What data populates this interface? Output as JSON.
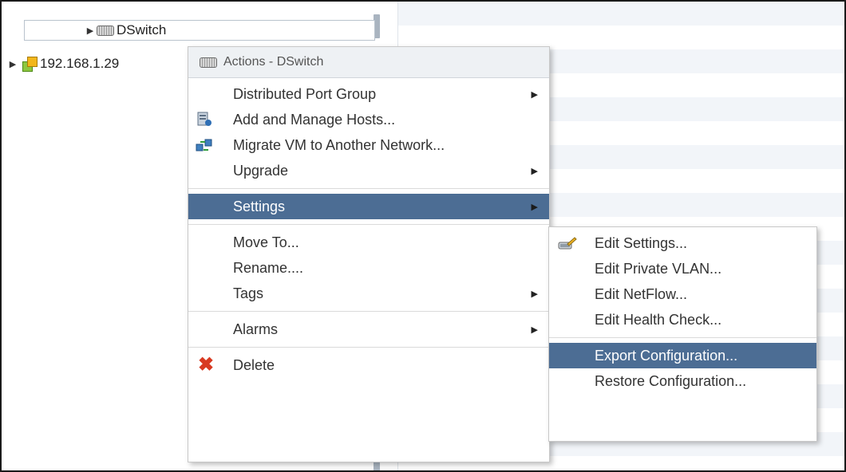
{
  "tree": {
    "switch_label": "DSwitch",
    "host_label": "192.168.1.29"
  },
  "menu": {
    "header": "Actions - DSwitch",
    "items": [
      {
        "label": "Distributed Port Group",
        "submenu": true
      },
      {
        "label": "Add and Manage Hosts...",
        "icon": "manage-hosts-icon"
      },
      {
        "label": "Migrate VM to Another Network...",
        "icon": "migrate-vm-icon"
      },
      {
        "label": "Upgrade",
        "submenu": true
      },
      {
        "label": "Settings",
        "submenu": true,
        "active": true
      },
      {
        "label": "Move To..."
      },
      {
        "label": "Rename...."
      },
      {
        "label": "Tags",
        "submenu": true
      },
      {
        "label": "Alarms",
        "submenu": true
      },
      {
        "label": "Delete",
        "icon": "delete-icon"
      }
    ]
  },
  "submenu": {
    "items": [
      {
        "label": "Edit Settings...",
        "icon": "edit-settings-icon"
      },
      {
        "label": "Edit Private VLAN..."
      },
      {
        "label": "Edit NetFlow..."
      },
      {
        "label": "Edit Health Check..."
      },
      {
        "label": "Export Configuration...",
        "active": true
      },
      {
        "label": "Restore Configuration..."
      }
    ]
  },
  "colors": {
    "highlight": "#4c6d94",
    "delete": "#d83a22"
  }
}
